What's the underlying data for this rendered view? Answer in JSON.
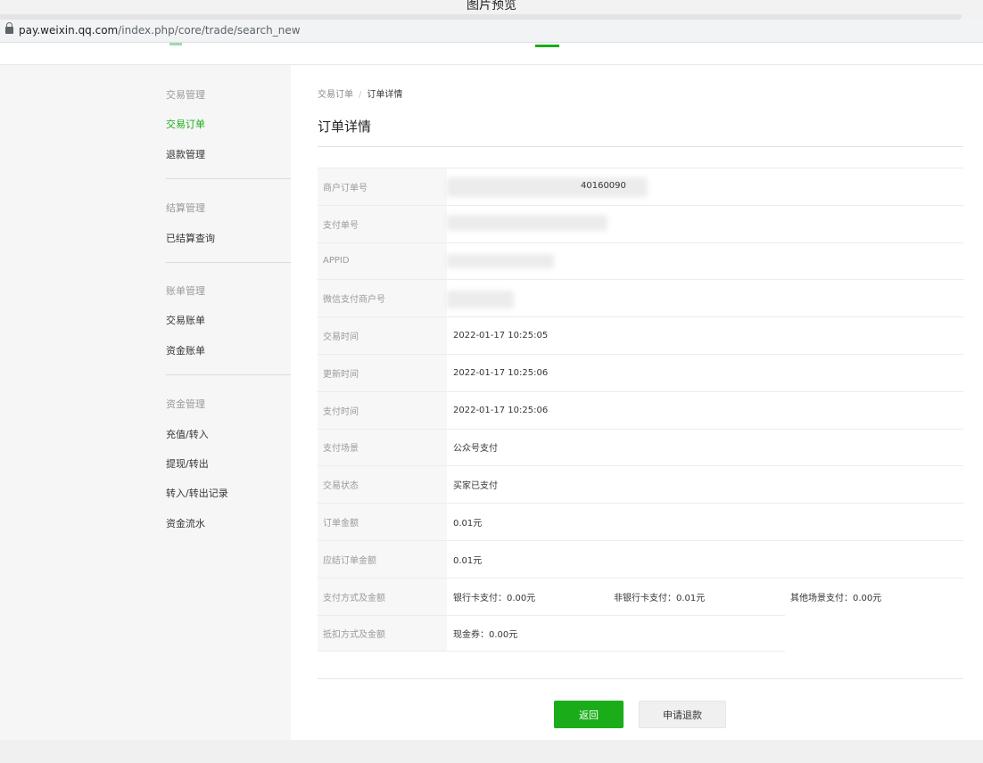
{
  "window": {
    "title": "图片预览"
  },
  "address_bar": {
    "host": "pay.weixin.qq.com",
    "path": "/index.php/core/trade/search_new"
  },
  "sidebar": {
    "groups": [
      {
        "title": "交易管理",
        "items": [
          "交易订单",
          "退款管理"
        ],
        "active": "交易订单"
      },
      {
        "title": "结算管理",
        "items": [
          "已结算查询"
        ]
      },
      {
        "title": "账单管理",
        "items": [
          "交易账单",
          "资金账单"
        ]
      },
      {
        "title": "资金管理",
        "items": [
          "充值/转入",
          "提现/转出",
          "转入/转出记录",
          "资金流水"
        ]
      }
    ]
  },
  "breadcrumb": {
    "parent": "交易订单",
    "separator": "/",
    "current": "订单详情"
  },
  "page_title": "订单详情",
  "details": {
    "merchant_order_no": {
      "label": "商户订单号",
      "value_visible_suffix": "40160090"
    },
    "pay_order_no": {
      "label": "支付单号"
    },
    "appid": {
      "label": "APPID"
    },
    "mch_id": {
      "label": "微信支付商户号"
    },
    "trade_time": {
      "label": "交易时间",
      "value": "2022-01-17 10:25:05"
    },
    "update_time": {
      "label": "更新时间",
      "value": "2022-01-17 10:25:06"
    },
    "pay_time": {
      "label": "支付时间",
      "value": "2022-01-17 10:25:06"
    },
    "scene": {
      "label": "支付场景",
      "value": "公众号支付"
    },
    "status": {
      "label": "交易状态",
      "value": "买家已支付"
    },
    "order_amount": {
      "label": "订单金额",
      "value": "0.01元"
    },
    "settle_amount": {
      "label": "应结订单金额",
      "value": "0.01元"
    },
    "pay_method": {
      "label": "支付方式及金额",
      "bank_card": "银行卡支付：0.00元",
      "non_bank_card": "非银行卡支付：0.01元",
      "other": "其他场景支付：0.00元"
    },
    "discount": {
      "label": "抵扣方式及金额",
      "value": "现金券：0.00元"
    }
  },
  "buttons": {
    "back": "返回",
    "refund": "申请退款"
  },
  "colors": {
    "accent": "#1aad19",
    "label_bg": "#f7f7f7",
    "sidebar_bg": "#f6f6f6"
  }
}
